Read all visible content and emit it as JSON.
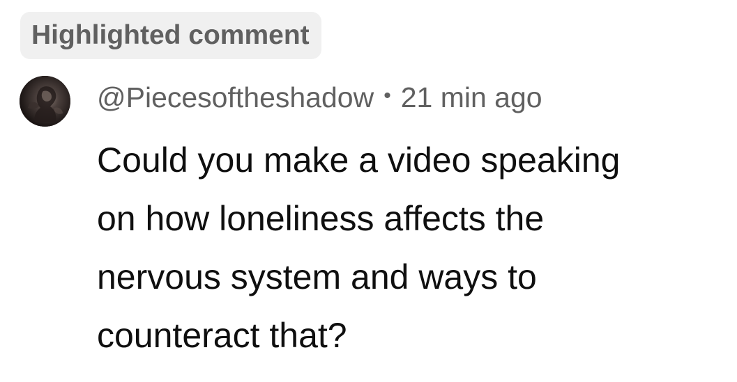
{
  "badge": {
    "label": "Highlighted comment"
  },
  "comment": {
    "author": "@Piecesoftheshadow",
    "separator": "•",
    "timestamp": "21 min ago",
    "text_lines": [
      "Could you make a video speaking",
      "on how loneliness affects the",
      "nervous system and ways to",
      "counteract that?"
    ],
    "avatar_icon": "user-avatar-dark-figure"
  }
}
